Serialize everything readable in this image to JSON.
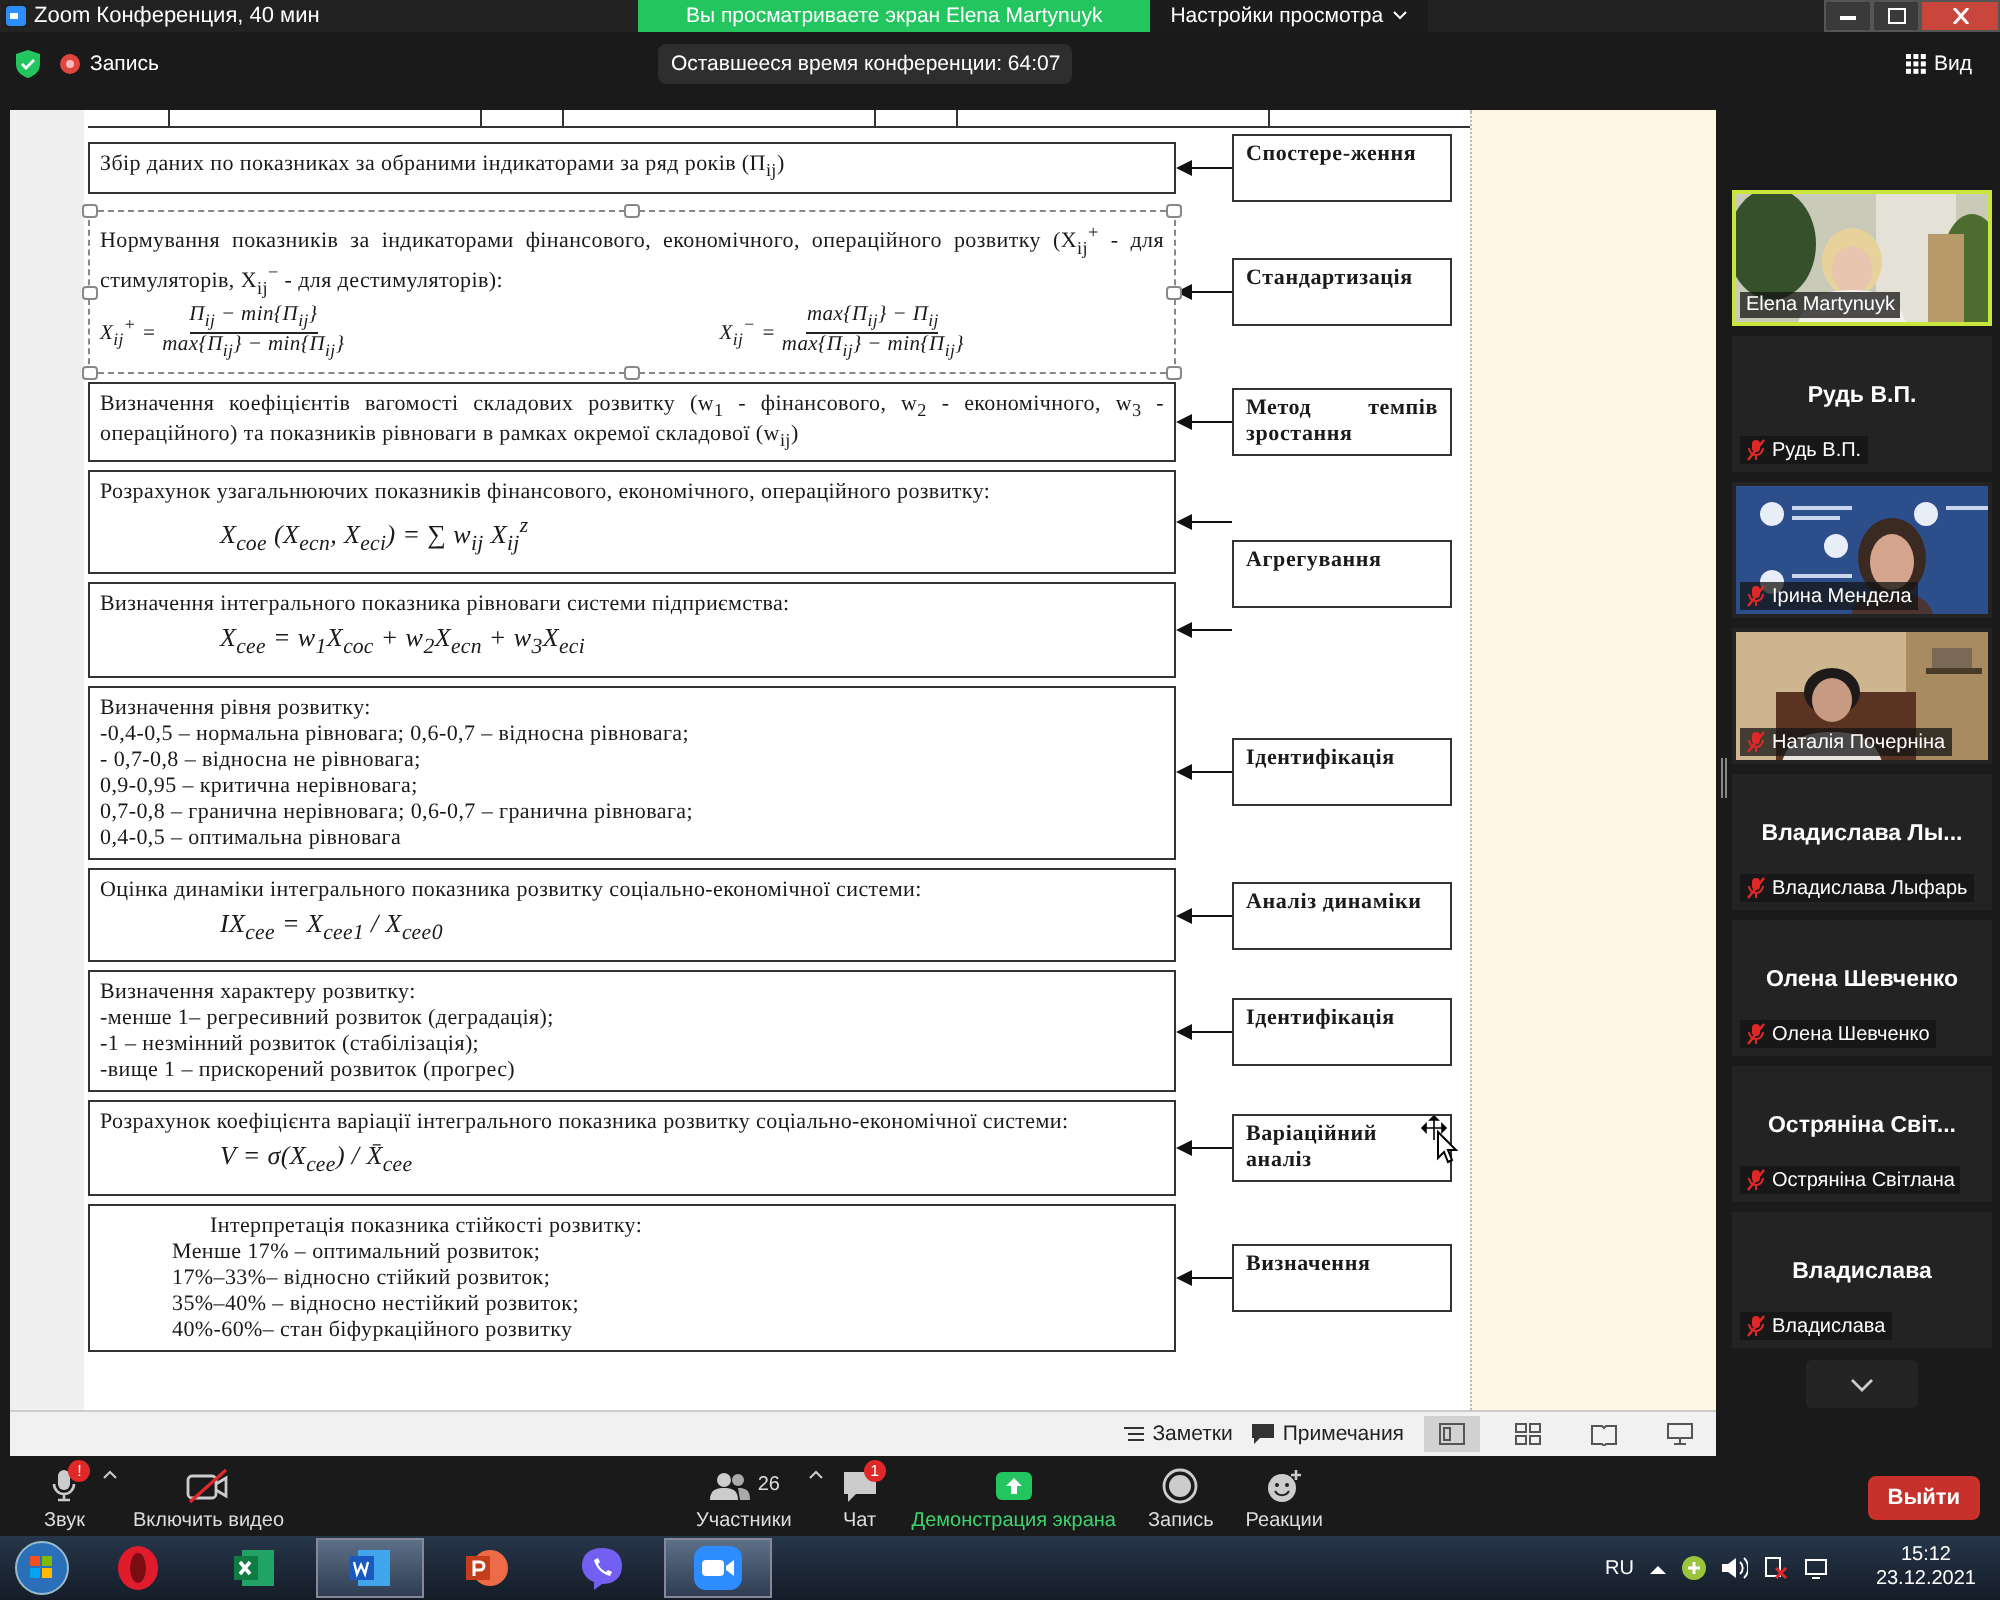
{
  "window": {
    "title": "Zoom Конференция, 40 мин"
  },
  "share_banner": {
    "text": "Вы просматриваете экран Elena Martynuyk",
    "options": "Настройки просмотра"
  },
  "top_bar": {
    "recording": "Запись",
    "time_left": "Оставшееся время конференции: 64:07",
    "view": "Вид"
  },
  "document": {
    "steps": [
      {
        "label": "Спостере-ження",
        "boxes": [
          {
            "selected": false,
            "paragraphs": [
              {
                "kind": "text",
                "text": "Збір даних по показниках за обраними індикаторами за ряд років (П$_{ij}$)"
              }
            ]
          }
        ]
      },
      {
        "label": "Стандартизація",
        "boxes": [
          {
            "selected": true,
            "paragraphs": [
              {
                "kind": "text",
                "text": "Нормування показників за індикаторами фінансового, економічного, операційного розвитку (X$_{ij}$$^{+}$ - для стимуляторів, X$_{ij}$$^{−}$ - для дестимуляторів):"
              },
              {
                "kind": "fractions",
                "items": [
                  {
                    "lhs": "X$_{ij}$$^{+}$ =",
                    "numerator": "П$_{ij}$ − min{П$_{ij}$}",
                    "denominator": "max{П$_{ij}$} − min{П$_{ij}$}"
                  },
                  {
                    "lhs": "X$_{ij}$$^{−}$ =",
                    "numerator": "max{П$_{ij}$} − П$_{ij}$",
                    "denominator": "max{П$_{ij}$} − min{П$_{ij}$}"
                  }
                ]
              }
            ]
          }
        ]
      },
      {
        "label": "Метод темпів зростання",
        "boxes": [
          {
            "selected": false,
            "paragraphs": [
              {
                "kind": "text",
                "text": "Визначення коефіцієнтів вагомості складових розвитку (w$_{1}$ - фінансового, w$_{2}$ - економічного, w$_{3}$ - операційного) та показників рівноваги в рамках окремої складової (w$_{ij}$)"
              }
            ]
          }
        ]
      },
      {
        "label": "Агрегування",
        "boxes": [
          {
            "selected": false,
            "paragraphs": [
              {
                "kind": "text",
                "text": "Розрахунок узагальнюючих показників фінансового, економічного, операційного розвитку:"
              },
              {
                "kind": "formula",
                "text": "X$_{сое}$ (X$_{есп}$, X$_{есі}$) = ∑ w$_{ij}$ X$_{ij}$$^{z}$"
              }
            ]
          },
          {
            "selected": false,
            "paragraphs": [
              {
                "kind": "text",
                "text": "Визначення інтегрального показника рівноваги системи підприємства:"
              },
              {
                "kind": "formula",
                "text": "X$_{сее}$ = w$_{1}$X$_{сос}$ + w$_{2}$X$_{есп}$ + w$_{3}$X$_{есі}$"
              }
            ]
          }
        ]
      },
      {
        "label": "Ідентифікація",
        "boxes": [
          {
            "selected": false,
            "paragraphs": [
              {
                "kind": "text",
                "text": "Визначення рівня розвитку:"
              },
              {
                "kind": "text",
                "text": "-0,4-0,5 – нормальна рівновага; 0,6-0,7 – відносна рівновага;"
              },
              {
                "kind": "text",
                "text": "- 0,7-0,8 – відносна не рівновага;"
              },
              {
                "kind": "text",
                "text": "0,9-0,95 – критична нерівновага;"
              },
              {
                "kind": "text",
                "text": "0,7-0,8 – гранична нерівновага; 0,6-0,7 – гранична рівновага;"
              },
              {
                "kind": "text",
                "text": "0,4-0,5 – оптимальна рівновага"
              }
            ]
          }
        ]
      },
      {
        "label": "Аналіз динаміки",
        "boxes": [
          {
            "selected": false,
            "paragraphs": [
              {
                "kind": "text",
                "text": "Оцінка динаміки інтегрального показника розвитку соціально-економічної системи:"
              },
              {
                "kind": "formula",
                "text": "IX$_{сее}$ = X$_{сее1}$ / X$_{сее0}$"
              }
            ]
          }
        ]
      },
      {
        "label": "Ідентифікація",
        "boxes": [
          {
            "selected": false,
            "paragraphs": [
              {
                "kind": "text",
                "text": "Визначення характеру розвитку:"
              },
              {
                "kind": "text",
                "text": "-менше 1– регресивний розвиток (деградація);"
              },
              {
                "kind": "text",
                "text": "-1 – незмінний розвиток (стабілізація);"
              },
              {
                "kind": "text",
                "text": "-вище 1 – прискорений розвиток (прогрес)"
              }
            ]
          }
        ]
      },
      {
        "label": "Варіаційний аналіз",
        "boxes": [
          {
            "selected": false,
            "paragraphs": [
              {
                "kind": "text",
                "text": "Розрахунок коефіцієнта варіації інтегрального показника розвитку соціально-економічної системи:"
              },
              {
                "kind": "formula",
                "text": "V = σ(X$_{сее}$) / X̄$_{сее}$"
              }
            ]
          }
        ]
      },
      {
        "label": "Визначення",
        "boxes": [
          {
            "selected": false,
            "paragraphs": [
              {
                "kind": "lead",
                "text": "Інтерпретація показника стійкості розвитку:"
              },
              {
                "kind": "item",
                "text": "Менше 17% – оптимальний розвиток;"
              },
              {
                "kind": "item",
                "text": "17%–33%– відносно стійкий розвиток;"
              },
              {
                "kind": "item",
                "text": "35%–40% – відносно нестійкий розвиток;"
              },
              {
                "kind": "item",
                "text": "40%-60%– стан біфуркаційного розвитку"
              }
            ]
          }
        ]
      }
    ],
    "notes": "Заметки",
    "comments": "Примечания",
    "view_modes": [
      {
        "kind": "normal",
        "selected": true
      },
      {
        "kind": "sorter",
        "selected": false
      },
      {
        "kind": "reading",
        "selected": false
      },
      {
        "kind": "slideshow",
        "selected": false
      }
    ]
  },
  "participants": [
    {
      "kind": "video",
      "name": "Elena Martynuyk",
      "muted": false,
      "speaking": true
    },
    {
      "kind": "name",
      "title": "Рудь В.П.",
      "name": "Рудь В.П.",
      "muted": true,
      "speaking": false
    },
    {
      "kind": "video",
      "name": "Ірина Мендела",
      "muted": true,
      "speaking": false
    },
    {
      "kind": "video",
      "name": "Наталія Почерніна",
      "muted": true,
      "speaking": false
    },
    {
      "kind": "name",
      "title": "Владислава  Лы...",
      "name": "Владислава Лыфарь",
      "muted": true,
      "speaking": false
    },
    {
      "kind": "name",
      "title": "Олена Шевченко",
      "name": "Олена Шевченко",
      "muted": true,
      "speaking": false
    },
    {
      "kind": "name",
      "title": "Остряніна  Світ...",
      "name": "Остряніна Світлана",
      "muted": true,
      "speaking": false
    },
    {
      "kind": "name",
      "title": "Владислава",
      "name": "Владислава",
      "muted": true,
      "speaking": false
    }
  ],
  "toolbar": [
    {
      "kind": "audio",
      "label": "Звук",
      "alert": "!",
      "menu": true
    },
    {
      "kind": "video",
      "label": "Включить видео",
      "off": true,
      "menu": false
    },
    {
      "kind": "participants",
      "label": "Участники",
      "count": "26",
      "menu": true
    },
    {
      "kind": "chat",
      "label": "Чат",
      "badge": "1",
      "menu": false
    },
    {
      "kind": "share",
      "label": "Демонстрация экрана",
      "menu": false
    },
    {
      "kind": "record",
      "label": "Запись",
      "menu": false
    },
    {
      "kind": "reactions",
      "label": "Реакции",
      "menu": false
    }
  ],
  "leave": "Выйти",
  "taskbar": {
    "apps": [
      {
        "kind": "opera",
        "active": false
      },
      {
        "kind": "excel",
        "active": false
      },
      {
        "kind": "word",
        "active": true
      },
      {
        "kind": "powerpoint",
        "active": false
      },
      {
        "kind": "viber",
        "active": false
      },
      {
        "kind": "zoom",
        "active": true
      }
    ],
    "language": "RU",
    "time": "15:12",
    "date": "23.12.2021"
  }
}
